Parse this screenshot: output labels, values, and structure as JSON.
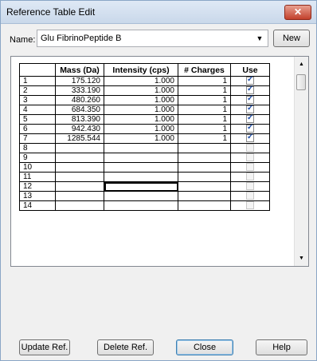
{
  "window": {
    "title": "Reference Table Edit"
  },
  "name_row": {
    "label": "Name:",
    "value": "Glu FibrinoPeptide B",
    "new_label": "New"
  },
  "table": {
    "columns": [
      "",
      "Mass (Da)",
      "Intensity (cps)",
      "# Charges",
      "Use"
    ],
    "rows": [
      {
        "n": "1",
        "mass": "175.120",
        "intensity": "1.000",
        "charges": "1",
        "use": true
      },
      {
        "n": "2",
        "mass": "333.190",
        "intensity": "1.000",
        "charges": "1",
        "use": true
      },
      {
        "n": "3",
        "mass": "480.260",
        "intensity": "1.000",
        "charges": "1",
        "use": true
      },
      {
        "n": "4",
        "mass": "684.350",
        "intensity": "1.000",
        "charges": "1",
        "use": true
      },
      {
        "n": "5",
        "mass": "813.390",
        "intensity": "1.000",
        "charges": "1",
        "use": true
      },
      {
        "n": "6",
        "mass": "942.430",
        "intensity": "1.000",
        "charges": "1",
        "use": true
      },
      {
        "n": "7",
        "mass": "1285.544",
        "intensity": "1.000",
        "charges": "1",
        "use": true
      },
      {
        "n": "8",
        "mass": "",
        "intensity": "",
        "charges": "",
        "use": false
      },
      {
        "n": "9",
        "mass": "",
        "intensity": "",
        "charges": "",
        "use": false
      },
      {
        "n": "10",
        "mass": "",
        "intensity": "",
        "charges": "",
        "use": false
      },
      {
        "n": "11",
        "mass": "",
        "intensity": "",
        "charges": "",
        "use": false
      },
      {
        "n": "12",
        "mass": "",
        "intensity": "",
        "charges": "",
        "use": false
      },
      {
        "n": "13",
        "mass": "",
        "intensity": "",
        "charges": "",
        "use": false
      },
      {
        "n": "14",
        "mass": "",
        "intensity": "",
        "charges": "",
        "use": false
      }
    ]
  },
  "buttons": {
    "update": "Update Ref.",
    "delete": "Delete Ref.",
    "close": "Close",
    "help": "Help"
  },
  "icons": {
    "close": "close-icon",
    "dropdown": "chevron-down-icon",
    "scroll_up": "scroll-up-icon",
    "scroll_down": "scroll-down-icon"
  }
}
